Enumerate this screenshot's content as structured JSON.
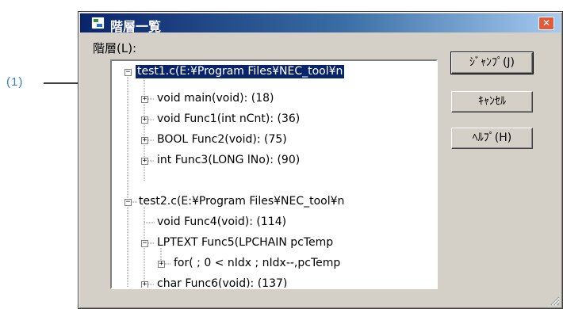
{
  "callout": {
    "label": "(1)"
  },
  "window": {
    "title": "階層一覧",
    "close_glyph": "✕"
  },
  "tree_label": "階層(L):",
  "tree": [
    {
      "text": "test1.c(E:¥Program Files¥NEC_tool¥n",
      "toggle": "−",
      "selected": true
    },
    {
      "text": "void main(void): (18)",
      "toggle": "+"
    },
    {
      "text": "void Func1(int nCnt): (36)",
      "toggle": "+"
    },
    {
      "text": "BOOL Func2(void): (75)",
      "toggle": "+"
    },
    {
      "text": "int Func3(LONG lNo): (90)",
      "toggle": "+"
    },
    {
      "text": "test2.c(E:¥Program Files¥NEC_tool¥n",
      "toggle": "−"
    },
    {
      "text": "void Func4(void): (114)",
      "toggle": ""
    },
    {
      "text": "LPTEXT Func5(LPCHAIN pcTemp",
      "toggle": "−"
    },
    {
      "text": "for( ; 0 < nIdx ; nIdx--,pcTemp",
      "toggle": "+"
    },
    {
      "text": "char Func6(void): (137)",
      "toggle": "+"
    }
  ],
  "buttons": {
    "jump": "ｼﾞｬﾝﾌﾟ(J)",
    "cancel": "ｷｬﾝｾﾙ",
    "help": "ﾍﾙﾌﾟ(H)"
  },
  "colors": {
    "selection": "#0a246a",
    "callout": "#2d7ec4",
    "face": "#d4d0c8"
  }
}
